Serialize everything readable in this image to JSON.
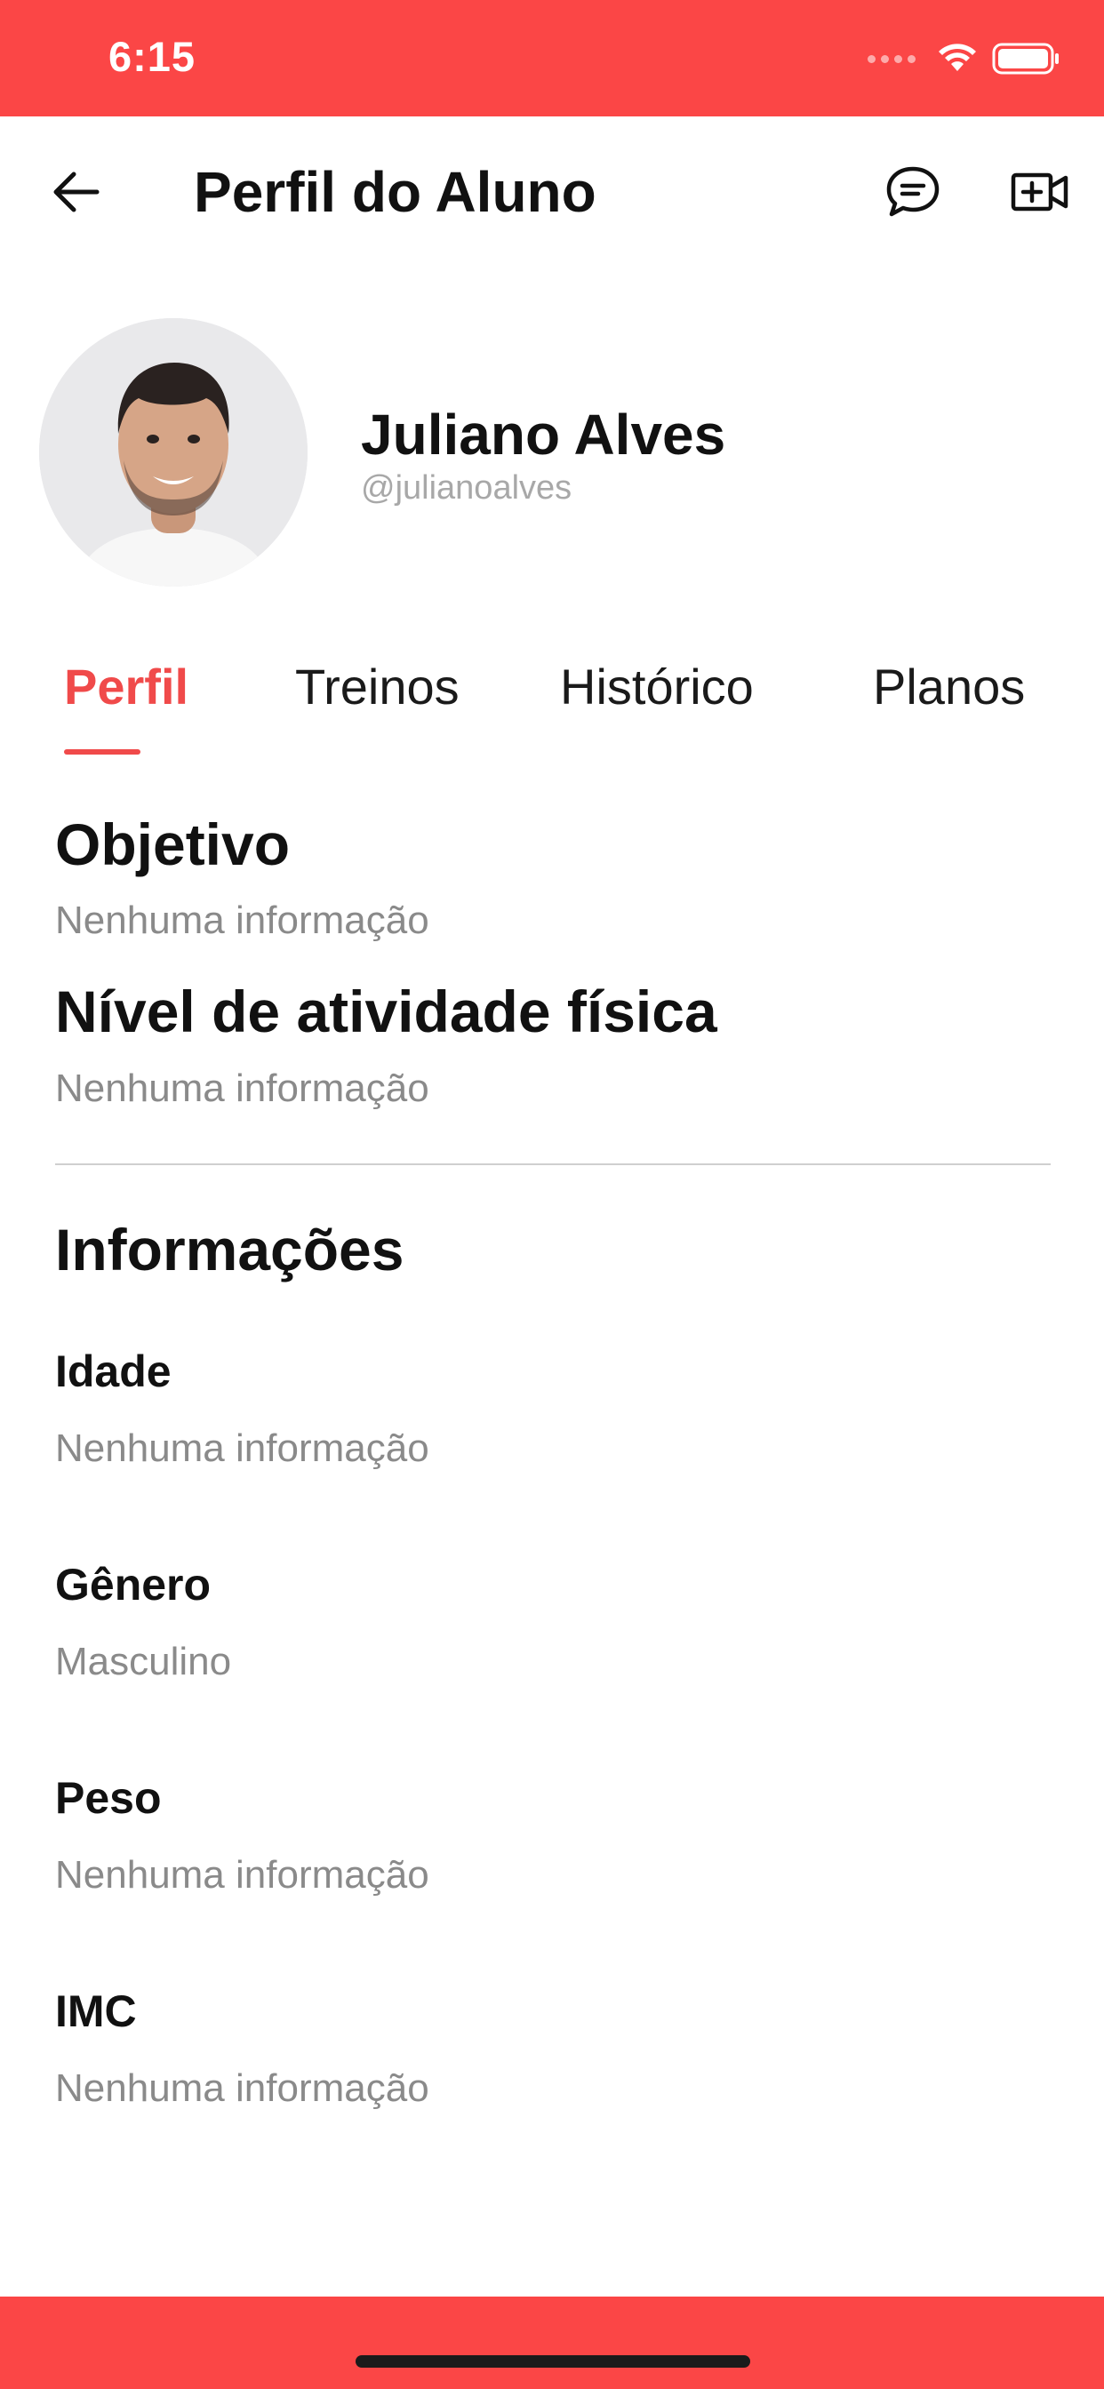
{
  "status_bar": {
    "time": "6:15",
    "icons": [
      "signal-icon",
      "wifi-icon",
      "battery-icon"
    ],
    "background_color": "#fb4646"
  },
  "header": {
    "title": "Perfil do Aluno",
    "back_icon": "arrow-left-icon",
    "chat_icon": "chat-bubble-icon",
    "video_icon": "video-add-icon"
  },
  "profile": {
    "name": "Juliano Alves",
    "username": "@julianoalves"
  },
  "tabs": [
    {
      "label": "Perfil",
      "active": true
    },
    {
      "label": "Treinos",
      "active": false
    },
    {
      "label": "Histórico",
      "active": false
    },
    {
      "label": "Planos",
      "active": false
    }
  ],
  "goal": {
    "title": "Objetivo",
    "value": "Nenhuma informação"
  },
  "activity_level": {
    "title": "Nível de atividade física",
    "value": "Nenhuma informação"
  },
  "info": {
    "title": "Informações",
    "fields": [
      {
        "label": "Idade",
        "value": "Nenhuma informação"
      },
      {
        "label": "Gênero",
        "value": "Masculino"
      },
      {
        "label": "Peso",
        "value": "Nenhuma informação"
      },
      {
        "label": "IMC",
        "value": "Nenhuma informação"
      }
    ]
  },
  "colors": {
    "accent": "#f04a4a",
    "bar": "#fb4646",
    "muted_text": "#8a8a8a"
  }
}
